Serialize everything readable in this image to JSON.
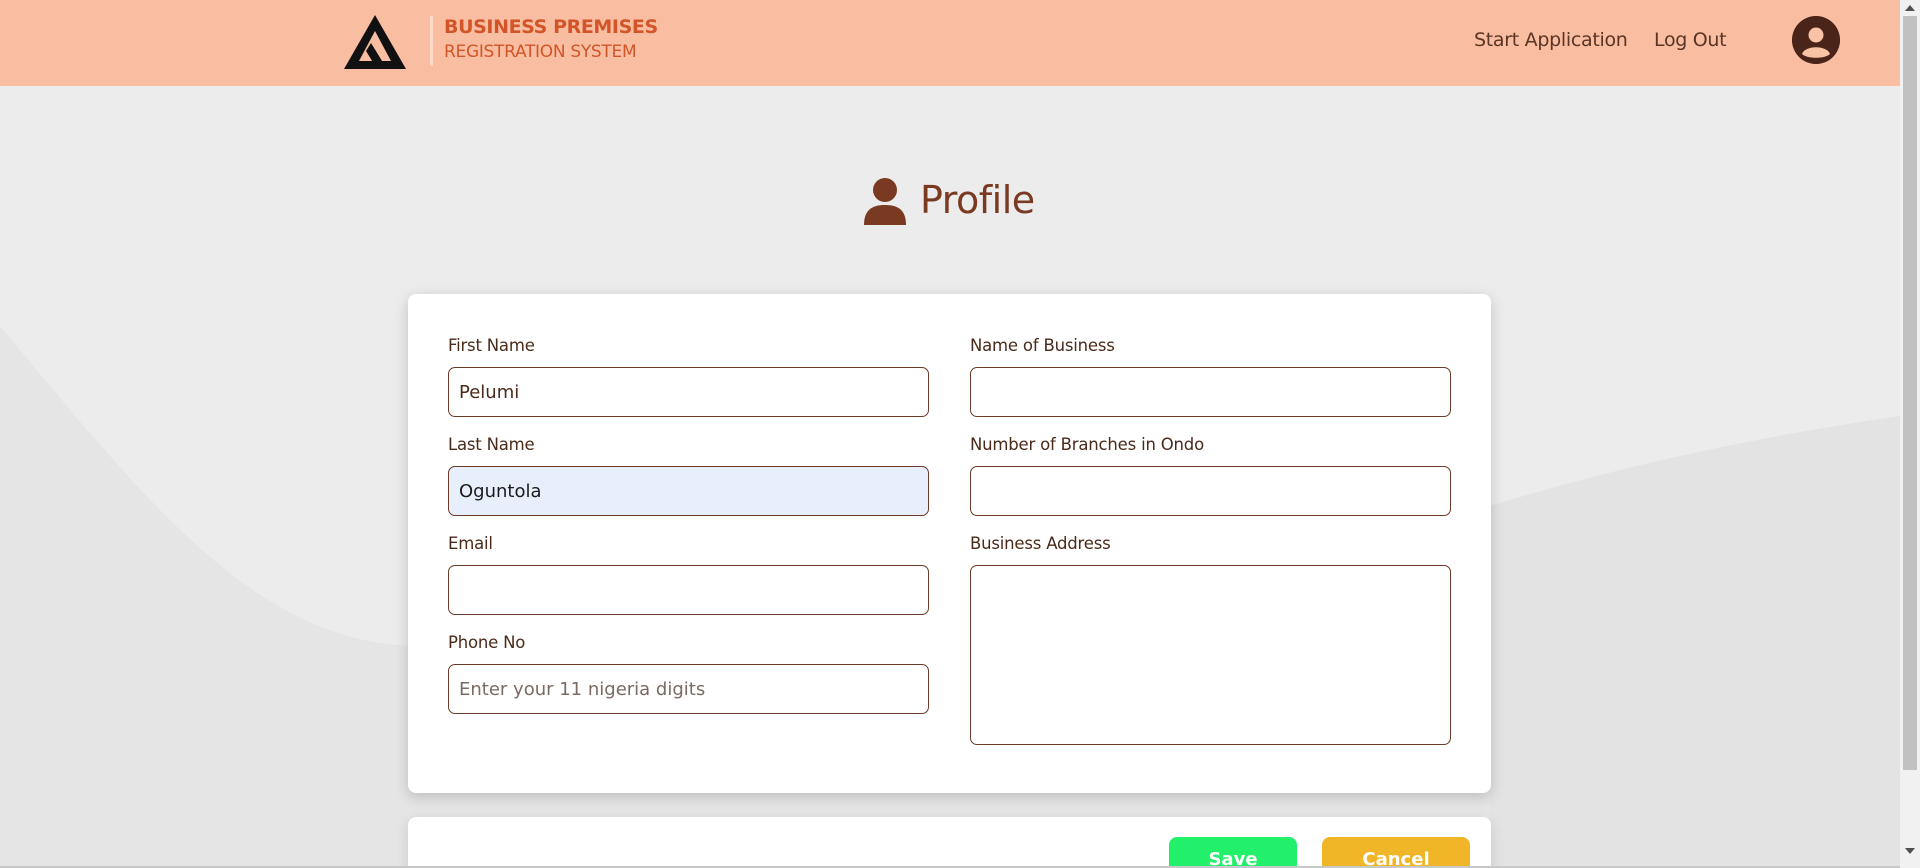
{
  "header": {
    "brand_line1": "BUSINESS PREMISES",
    "brand_line2": "REGISTRATION SYSTEM",
    "nav": {
      "start_application": "Start Application",
      "log_out": "Log Out"
    },
    "colors": {
      "background": "#f9bea2",
      "brand_text": "#d2552a"
    }
  },
  "page": {
    "title": "Profile"
  },
  "form": {
    "first_name": {
      "label": "First Name",
      "value": "Pelumi"
    },
    "last_name": {
      "label": "Last Name",
      "value": "Oguntola"
    },
    "email": {
      "label": "Email",
      "value": ""
    },
    "phone": {
      "label": "Phone No",
      "value": "",
      "placeholder": "Enter your 11 nigeria digits"
    },
    "business_name": {
      "label": "Name of Business",
      "value": ""
    },
    "branches": {
      "label": "Number of Branches in Ondo",
      "value": ""
    },
    "business_address": {
      "label": "Business Address",
      "value": ""
    }
  },
  "actions": {
    "save": "Save",
    "cancel": "Cancel",
    "colors": {
      "save": "#22f06a",
      "cancel": "#f0b628"
    }
  }
}
